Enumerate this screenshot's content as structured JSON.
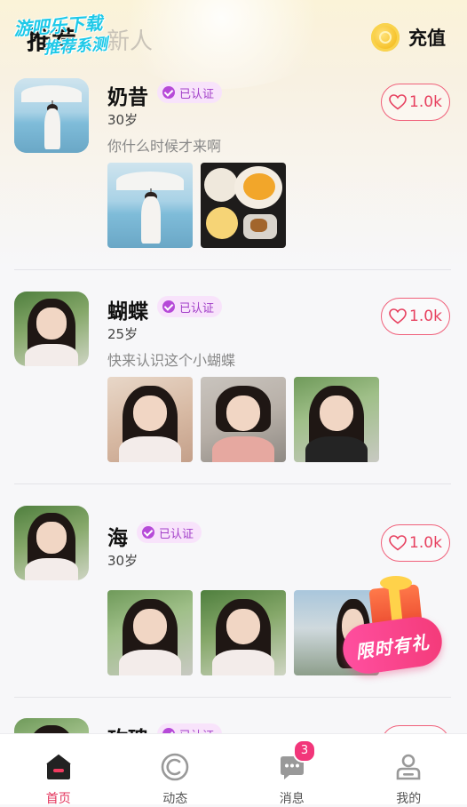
{
  "header": {
    "tabs": [
      {
        "label": "推荐",
        "active": true
      },
      {
        "label": "新人",
        "active": false
      }
    ],
    "watermark_line1": "游吧乐下载",
    "watermark_line2": "推荐系测",
    "recharge_label": "充值"
  },
  "users": [
    {
      "name": "奶昔",
      "verified": "已认证",
      "age": "30岁",
      "bio": "你什么时候才来啊",
      "likes": "1.0k",
      "photos": [
        "umbrella-photo",
        "food-photo"
      ]
    },
    {
      "name": "蝴蝶",
      "verified": "已认证",
      "age": "25岁",
      "bio": "快来认识这个小蝴蝶",
      "likes": "1.0k",
      "photos": [
        "portrait-photo",
        "portrait-photo",
        "portrait-photo"
      ]
    },
    {
      "name": "海",
      "verified": "已认证",
      "age": "30岁",
      "bio": "",
      "likes": "1.0k",
      "photos": [
        "portrait-photo",
        "portrait-photo",
        "portrait-photo"
      ]
    },
    {
      "name": "玫瑰",
      "verified": "已认证",
      "likes": ""
    }
  ],
  "gift": {
    "label": "限时有礼"
  },
  "tabbar": {
    "items": [
      {
        "label": "首页",
        "icon": "home-icon",
        "active": true
      },
      {
        "label": "动态",
        "icon": "moments-icon",
        "active": false
      },
      {
        "label": "消息",
        "icon": "message-icon",
        "active": false,
        "badge": "3"
      },
      {
        "label": "我的",
        "icon": "profile-icon",
        "active": false
      }
    ]
  },
  "colors": {
    "accent": "#e3355c",
    "verified_bg": "#f8e3fb",
    "verified_text": "#a23fc8",
    "like_border": "#f0607a",
    "badge": "#f2367a",
    "watermark": "#1ec9e8"
  }
}
